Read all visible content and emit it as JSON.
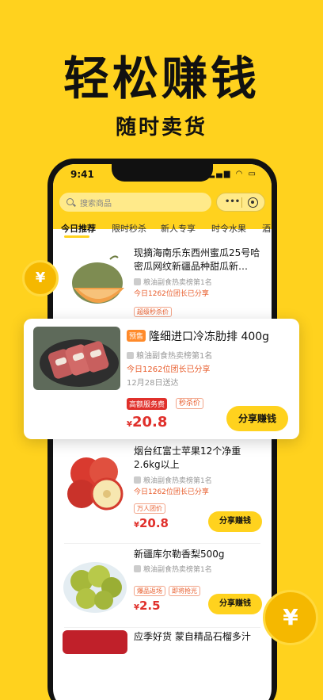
{
  "hero": {
    "title": "轻松赚钱",
    "subtitle": "随时卖货"
  },
  "status_bar": {
    "time": "9:41",
    "icons": "▂▄▆ ◠ ▭"
  },
  "search": {
    "placeholder": "搜索商品"
  },
  "capsule": {
    "more": "•••"
  },
  "tabs": [
    {
      "label": "今日推荐",
      "active": true
    },
    {
      "label": "限时秒杀"
    },
    {
      "label": "新人专享"
    },
    {
      "label": "时令水果"
    },
    {
      "label": "酒"
    }
  ],
  "items": [
    {
      "title": "现摘海南乐东西州蜜瓜25号哈密瓜网纹新疆品种甜瓜新…",
      "rank": "粮油副食热卖榜第1名",
      "leaders": "今日1262位团长已分享",
      "tags": [
        "超级秒杀价"
      ]
    },
    {
      "title": "烟台红富士苹果12个净重2.6kg以上",
      "rank": "粮油副食热卖榜第1名",
      "leaders": "今日1262位团长已分享",
      "tags": [
        "万人团价"
      ],
      "currency": "¥",
      "price": "20.8",
      "share_label": "分享赚钱"
    },
    {
      "title": "新疆库尔勒香梨500g",
      "rank": "粮油副食热卖榜第1名",
      "tags": [
        "爆品返场",
        "即将抢光"
      ],
      "currency": "¥",
      "price": "2.5",
      "share_label": "分享赚钱"
    },
    {
      "title": "应季好货 蒙自精品石榴多汁"
    }
  ],
  "featured": {
    "presale": "预售",
    "title": "隆细进口冷冻肋排 400g",
    "rank": "粮油副食热卖榜第1名",
    "leaders": "今日1262位团长已分享",
    "delivery": "12月28日送达",
    "tags": [
      "高额服务费",
      "秒杀价"
    ],
    "currency": "¥",
    "price": "20.8",
    "share_label": "分享赚钱"
  },
  "coin_symbol": "¥"
}
